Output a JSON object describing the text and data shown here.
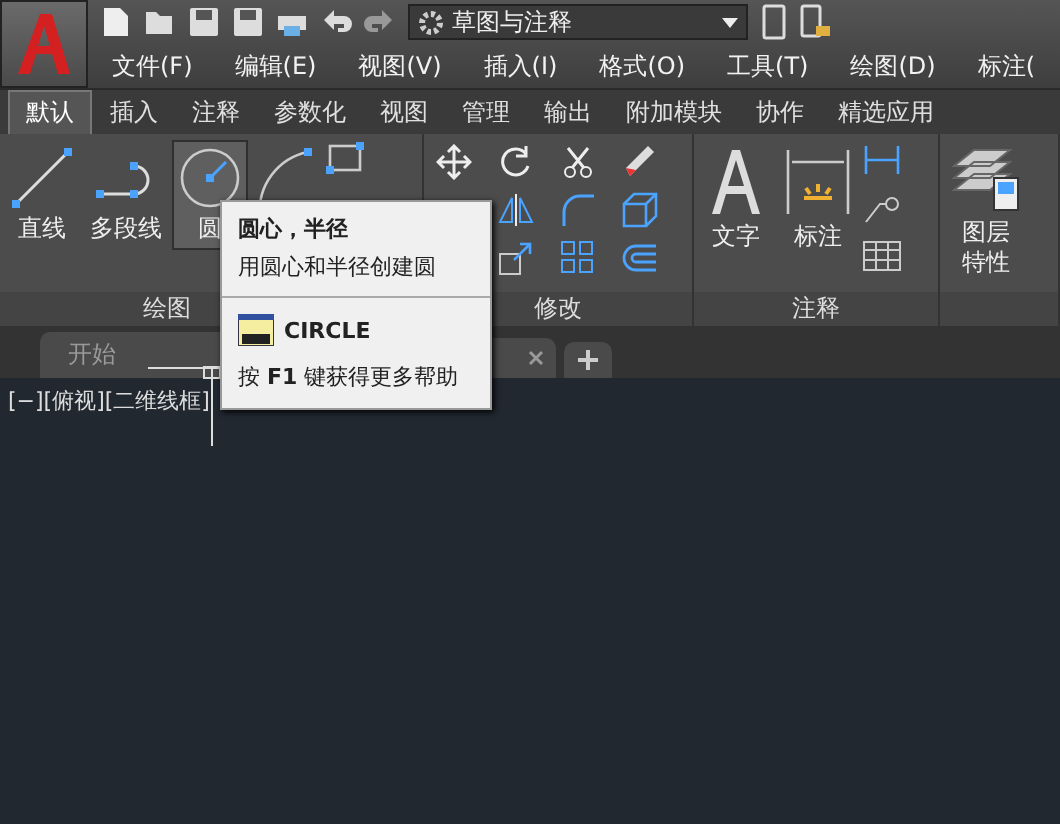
{
  "quick_access": {
    "workspace": "草图与注释"
  },
  "menu_bar": [
    "文件(F)",
    "编辑(E)",
    "视图(V)",
    "插入(I)",
    "格式(O)",
    "工具(T)",
    "绘图(D)",
    "标注("
  ],
  "ribbon_tabs": [
    {
      "label": "默认",
      "selected": true
    },
    {
      "label": "插入",
      "selected": false
    },
    {
      "label": "注释",
      "selected": false
    },
    {
      "label": "参数化",
      "selected": false
    },
    {
      "label": "视图",
      "selected": false
    },
    {
      "label": "管理",
      "selected": false
    },
    {
      "label": "输出",
      "selected": false
    },
    {
      "label": "附加模块",
      "selected": false
    },
    {
      "label": "协作",
      "selected": false
    },
    {
      "label": "精选应用",
      "selected": false
    }
  ],
  "ribbon_panels": [
    {
      "title": "绘图",
      "buttons": [
        {
          "kind": "line",
          "label": "直线",
          "highlighted": false
        },
        {
          "kind": "polyline",
          "label": "多段线",
          "highlighted": false
        },
        {
          "kind": "circle",
          "label": "圆",
          "highlighted": true
        },
        {
          "kind": "arc-tools"
        }
      ]
    },
    {
      "title": "修改",
      "buttons": [
        {
          "kind": "modify-tools"
        }
      ]
    },
    {
      "title": "注释",
      "buttons": [
        {
          "kind": "text",
          "label": "文字",
          "highlighted": false
        },
        {
          "kind": "dimension",
          "label": "标注",
          "highlighted": false
        },
        {
          "kind": "annotation-tools"
        }
      ]
    },
    {
      "buttons": [
        {
          "kind": "layer",
          "label": "图层特性",
          "highlighted": false
        }
      ]
    }
  ],
  "file_tabs": [
    {
      "label": "开始"
    }
  ],
  "viewport_label": "[−][俯视][二维线框]",
  "tooltip": {
    "title": "圆心，半径",
    "description": "用圆心和半径创建圆",
    "command": "CIRCLE",
    "help": "按 **F1** 键获得更多帮助"
  }
}
